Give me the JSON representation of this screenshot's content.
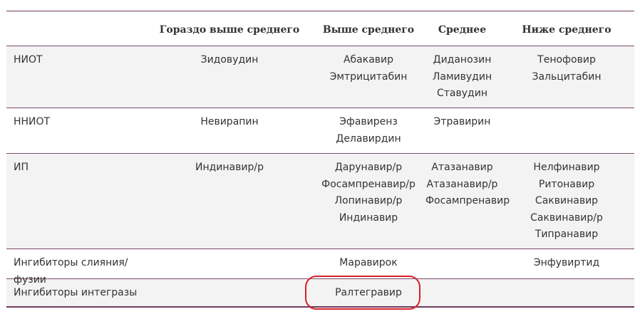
{
  "table": {
    "headers": [
      "",
      "Гораздо выше среднего",
      "Выше среднего",
      "Среднее",
      "Ниже среднего"
    ],
    "rows": [
      {
        "label": "НИОТ",
        "cells": [
          [
            "Зидовудин"
          ],
          [
            "Абакавир",
            "Эмтрицитабин"
          ],
          [
            "Диданозин",
            "Ламивудин",
            "Ставудин"
          ],
          [
            "Тенофовир",
            "Зальцитабин"
          ]
        ]
      },
      {
        "label": "ННИОТ",
        "cells": [
          [
            "Невирапин"
          ],
          [
            "Эфавиренз",
            "Делавирдин"
          ],
          [
            "Этравирин"
          ],
          []
        ]
      },
      {
        "label": "ИП",
        "cells": [
          [
            "Индинавир/р"
          ],
          [
            "Дарунавир/р",
            "Фосампренавир/р",
            "Лопинавир/р",
            "Индинавир"
          ],
          [
            "Атазанавир",
            "Атазанавир/р",
            "Фосампренавир"
          ],
          [
            "Нелфинавир",
            "Ритонавир",
            "Саквинавир",
            "Саквинавир/р",
            "Типранавир"
          ]
        ]
      },
      {
        "label": "Ингибиторы слияния/фузии",
        "cells": [
          [],
          [
            "Маравирок"
          ],
          [],
          [
            "Энфувиртид"
          ]
        ]
      },
      {
        "label": "Ингибиторы интегразы",
        "cells": [
          [],
          [
            "Ралтегравир"
          ],
          [],
          []
        ]
      }
    ]
  },
  "colors": {
    "rule": "#7b4a6c",
    "shade": "#f3f3f3",
    "highlight": "#d8202a"
  }
}
